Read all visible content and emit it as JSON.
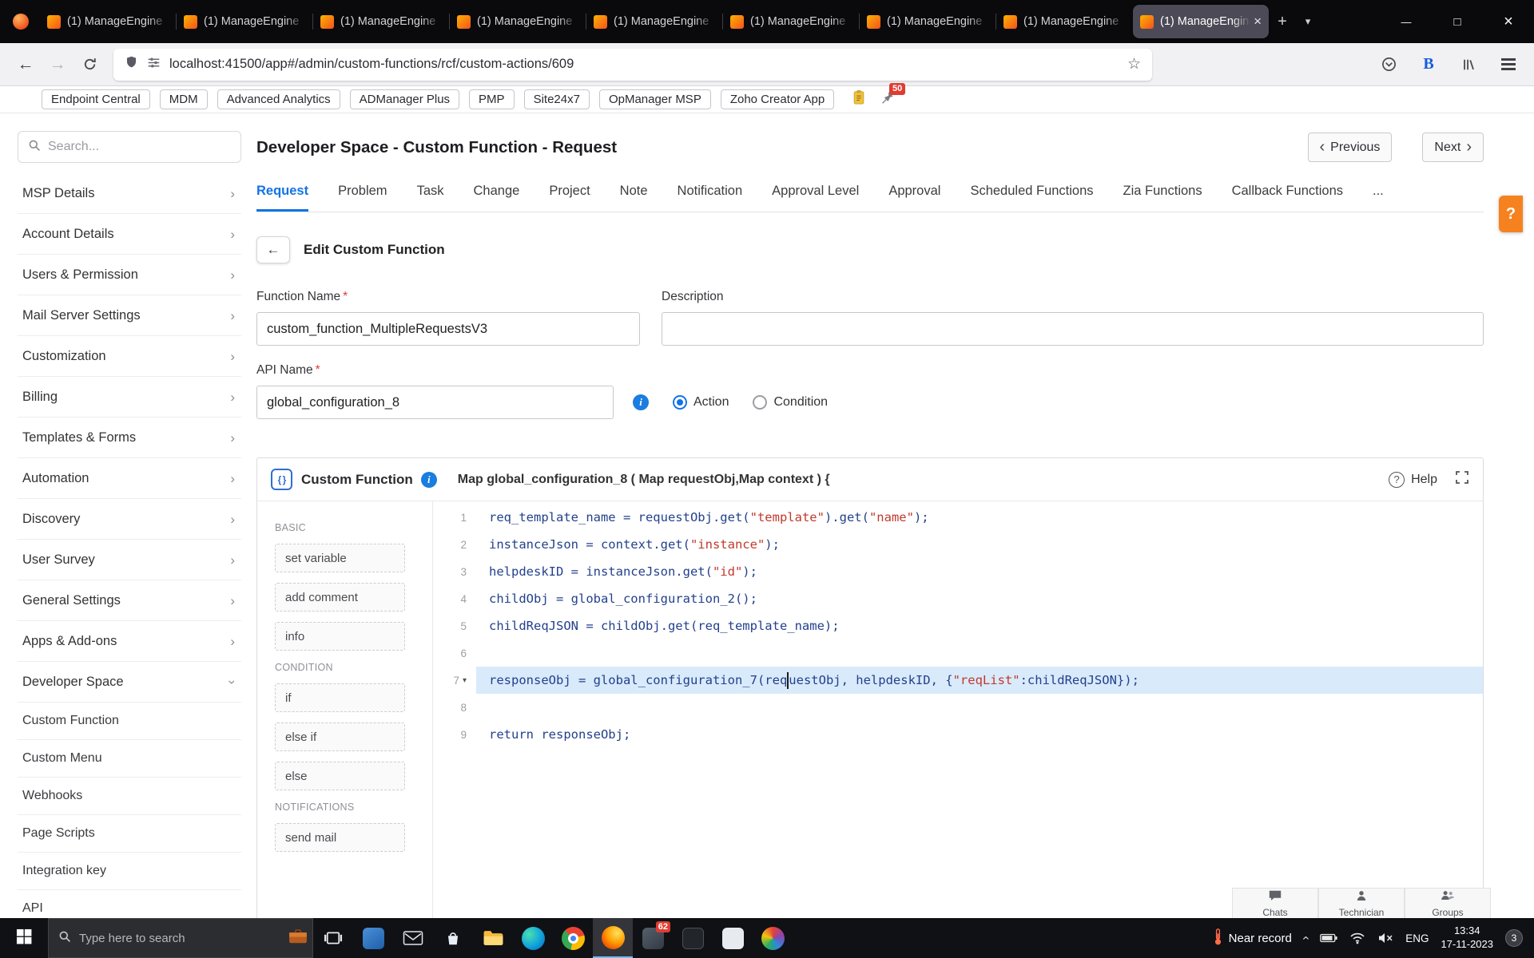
{
  "browser": {
    "tabs": [
      {
        "label": "(1) ManageEngine",
        "active": false
      },
      {
        "label": "(1) ManageEngine",
        "active": false
      },
      {
        "label": "(1) ManageEngine",
        "active": false
      },
      {
        "label": "(1) ManageEngine",
        "active": false
      },
      {
        "label": "(1) ManageEngine",
        "active": false
      },
      {
        "label": "(1) ManageEngine",
        "active": false
      },
      {
        "label": "(1) ManageEngine",
        "active": false
      },
      {
        "label": "(1) ManageEngine",
        "active": false
      },
      {
        "label": "(1) ManageEngine",
        "active": true
      }
    ],
    "url": "localhost:41500/app#/admin/custom-functions/rcf/custom-actions/609",
    "bookmarks": [
      "Endpoint Central",
      "MDM",
      "Advanced Analytics",
      "ADManager Plus",
      "PMP",
      "Site24x7",
      "OpManager MSP",
      "Zoho Creator App"
    ],
    "pin_badge": "50"
  },
  "sidebar": {
    "search_placeholder": "Search...",
    "items": [
      {
        "label": "MSP Details"
      },
      {
        "label": "Account Details"
      },
      {
        "label": "Users & Permission"
      },
      {
        "label": "Mail Server Settings"
      },
      {
        "label": "Customization"
      },
      {
        "label": "Billing"
      },
      {
        "label": "Templates & Forms"
      },
      {
        "label": "Automation"
      },
      {
        "label": "Discovery"
      },
      {
        "label": "User Survey"
      },
      {
        "label": "General Settings"
      },
      {
        "label": "Apps & Add-ons"
      },
      {
        "label": "Developer Space",
        "expanded": true
      }
    ],
    "children": [
      {
        "label": "Custom Function",
        "selected": true
      },
      {
        "label": "Custom Menu"
      },
      {
        "label": "Webhooks"
      },
      {
        "label": "Page Scripts"
      },
      {
        "label": "Integration key"
      },
      {
        "label": "API"
      }
    ]
  },
  "page": {
    "title": "Developer Space - Custom Function - Request",
    "prev_label": "Previous",
    "next_label": "Next",
    "tabs": [
      {
        "label": "Request",
        "active": true
      },
      {
        "label": "Problem"
      },
      {
        "label": "Task"
      },
      {
        "label": "Change"
      },
      {
        "label": "Project"
      },
      {
        "label": "Note"
      },
      {
        "label": "Notification"
      },
      {
        "label": "Approval Level"
      },
      {
        "label": "Approval"
      },
      {
        "label": "Scheduled Functions"
      },
      {
        "label": "Zia Functions"
      },
      {
        "label": "Callback Functions"
      }
    ],
    "more_tabs": "...",
    "help_tab": "?"
  },
  "form": {
    "edit_title": "Edit Custom Function",
    "required_mark": "*",
    "function_name_label": "Function Name",
    "function_name_value": "custom_function_MultipleRequestsV3",
    "description_label": "Description",
    "api_name_label": "API Name",
    "api_name_value": "global_configuration_8",
    "radio_action": "Action",
    "radio_condition": "Condition"
  },
  "editor": {
    "title": "Custom Function",
    "signature": "Map global_configuration_8 ( Map requestObj,Map context ) {",
    "help_label": "Help",
    "palette": [
      {
        "section": "BASIC",
        "items": [
          "set variable",
          "add comment",
          "info"
        ]
      },
      {
        "section": "CONDITION",
        "items": [
          "if",
          "else if",
          "else"
        ]
      },
      {
        "section": "NOTIFICATIONS",
        "items": [
          "send mail"
        ]
      }
    ],
    "selected_line": 7,
    "lines": [
      {
        "n": 1,
        "tokens": [
          {
            "t": "req_template_name = requestObj.get("
          },
          {
            "t": "\"template\"",
            "c": "str"
          },
          {
            "t": ").get("
          },
          {
            "t": "\"name\"",
            "c": "str"
          },
          {
            "t": ");"
          }
        ]
      },
      {
        "n": 2,
        "tokens": [
          {
            "t": "instanceJson = context.get("
          },
          {
            "t": "\"instance\"",
            "c": "str"
          },
          {
            "t": ");"
          }
        ]
      },
      {
        "n": 3,
        "tokens": [
          {
            "t": "helpdeskID = instanceJson.get("
          },
          {
            "t": "\"id\"",
            "c": "str"
          },
          {
            "t": ");"
          }
        ]
      },
      {
        "n": 4,
        "tokens": [
          {
            "t": "childObj = global_configuration_2();"
          }
        ]
      },
      {
        "n": 5,
        "tokens": [
          {
            "t": "childReqJSON = childObj.get(req_template_name);"
          }
        ]
      },
      {
        "n": 6,
        "tokens": []
      },
      {
        "n": 7,
        "tokens": [
          {
            "t": "responseObj = global_configuration_7(req"
          },
          {
            "c": "caret"
          },
          {
            "t": "uestObj, helpdeskID, {"
          },
          {
            "t": "\"reqList\"",
            "c": "str"
          },
          {
            "t": ":childReqJSON});"
          }
        ]
      },
      {
        "n": 8,
        "tokens": []
      },
      {
        "n": 9,
        "tokens": [
          {
            "t": "return responseObj;"
          }
        ]
      }
    ]
  },
  "dock": {
    "items": [
      {
        "icon": "chat-icon",
        "label": "Chats"
      },
      {
        "icon": "technician-icon",
        "label": "Technician"
      },
      {
        "icon": "groups-icon",
        "label": "Groups"
      }
    ]
  },
  "taskbar": {
    "search_placeholder": "Type here to search",
    "apps": [
      {
        "name": "task-view"
      },
      {
        "name": "app-blue"
      },
      {
        "name": "mail"
      },
      {
        "name": "store"
      },
      {
        "name": "file-explorer"
      },
      {
        "name": "edge"
      },
      {
        "name": "chrome"
      },
      {
        "name": "firefox",
        "active": true
      },
      {
        "name": "app-badged",
        "badge": "62"
      },
      {
        "name": "app-dark"
      },
      {
        "name": "app-light"
      },
      {
        "name": "app-color"
      }
    ],
    "tray": {
      "weather": "Near record",
      "language": "ENG",
      "time": "13:34",
      "date": "17-11-2023",
      "notification_count": "3"
    }
  },
  "colors": {
    "accent_blue": "#1373e6",
    "code_default": "#23418c",
    "code_string": "#c0392b",
    "help_orange": "#f6821f",
    "selected_line_bg": "#d9eafb"
  }
}
